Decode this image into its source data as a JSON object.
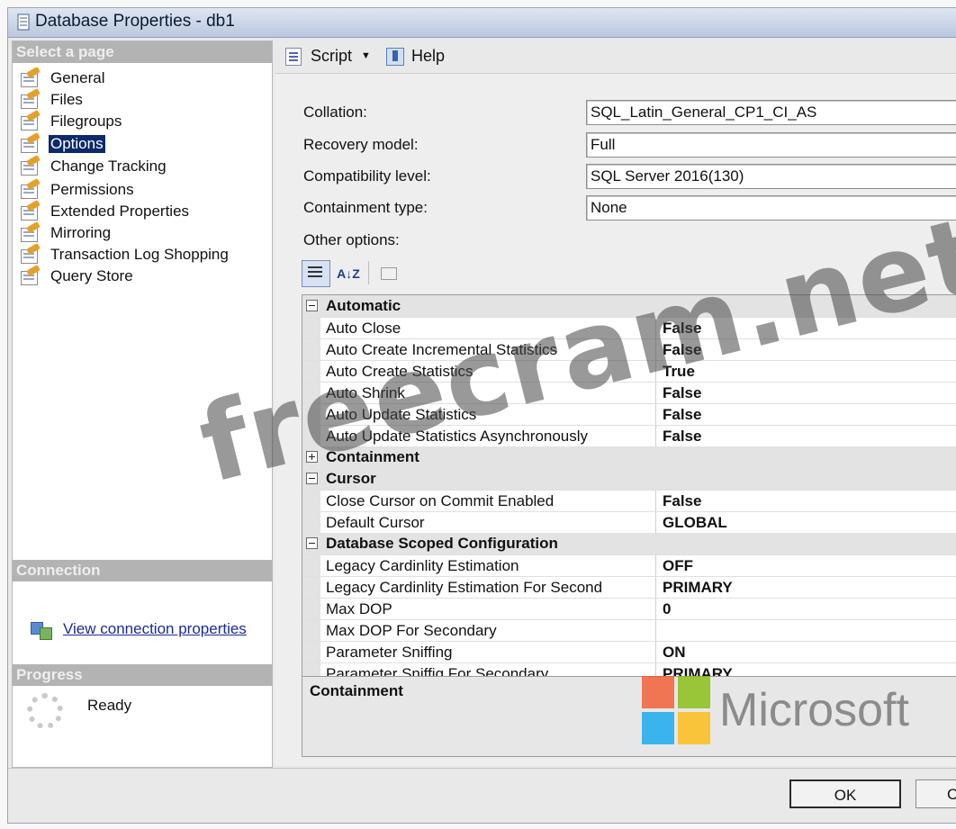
{
  "window": {
    "title": "Database Properties - db1"
  },
  "left_pane": {
    "select_page_header": "Select a page",
    "pages": [
      {
        "label": "General",
        "selected": false
      },
      {
        "label": "Files",
        "selected": false
      },
      {
        "label": "Filegroups",
        "selected": false
      },
      {
        "label": "Options",
        "selected": true
      },
      {
        "label": "Change Tracking",
        "selected": false
      },
      {
        "label": "Permissions",
        "selected": false
      },
      {
        "label": "Extended Properties",
        "selected": false
      },
      {
        "label": "Mirroring",
        "selected": false
      },
      {
        "label": "Transaction Log Shopping",
        "selected": false
      },
      {
        "label": "Query Store",
        "selected": false
      }
    ],
    "connection_header": "Connection",
    "connection_link": "View connection properties",
    "progress_header": "Progress",
    "progress_status": "Ready"
  },
  "toolbar": {
    "script_label": "Script",
    "help_label": "Help"
  },
  "fields": {
    "collation": {
      "label": "Collation:",
      "value": "SQL_Latin_General_CP1_CI_AS"
    },
    "recovery_model": {
      "label": "Recovery model:",
      "value": "Full"
    },
    "compatibility_level": {
      "label": "Compatibility level:",
      "value": "SQL Server 2016(130)"
    },
    "containment_type": {
      "label": "Containment type:",
      "value": "None"
    }
  },
  "other_options_label": "Other options:",
  "grid_toolbar": {
    "sort_az_label": "A↓Z"
  },
  "property_grid": {
    "categories": [
      {
        "name": "Automatic",
        "expanded": true,
        "rows": [
          {
            "name": "Auto Close",
            "value": "False"
          },
          {
            "name": "Auto Create Incremental Statistics",
            "value": "False"
          },
          {
            "name": "Auto Create Statistics",
            "value": "True"
          },
          {
            "name": "Auto Shrink",
            "value": "False"
          },
          {
            "name": "Auto Update Statistics",
            "value": "False"
          },
          {
            "name": "Auto Update Statistics Asynchronously",
            "value": "False"
          }
        ]
      },
      {
        "name": "Containment",
        "expanded": false,
        "rows": []
      },
      {
        "name": "Cursor",
        "expanded": true,
        "rows": [
          {
            "name": "Close Cursor on Commit Enabled",
            "value": "False"
          },
          {
            "name": "Default Cursor",
            "value": "GLOBAL"
          }
        ]
      },
      {
        "name": "Database Scoped Configuration",
        "expanded": true,
        "rows": [
          {
            "name": "Legacy Cardinlity Estimation",
            "value": "OFF"
          },
          {
            "name": "Legacy Cardinlity Estimation For Second",
            "value": "PRIMARY"
          },
          {
            "name": "Max DOP",
            "value": "0"
          },
          {
            "name": "Max DOP For Secondary",
            "value": ""
          },
          {
            "name": "Parameter Sniffing",
            "value": "ON"
          },
          {
            "name": "Parameter Sniffig For Secondary",
            "value": "PRIMARY"
          }
        ]
      }
    ]
  },
  "description_panel": {
    "title": "Containment"
  },
  "logo": {
    "text": "Microsoft",
    "colors": [
      "#f25022",
      "#7fba00",
      "#00a4ef",
      "#ffb900"
    ]
  },
  "watermark": "freecram.net",
  "buttons": {
    "ok": "OK",
    "cancel": "Cancel"
  }
}
